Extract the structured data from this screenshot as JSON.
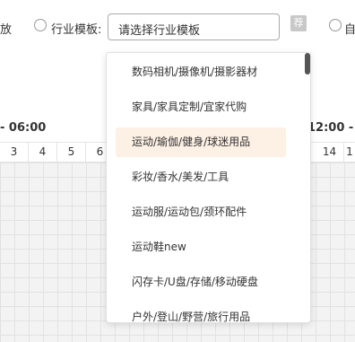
{
  "top": {
    "left_cut_text": "放",
    "field_label": "行业模板:",
    "select_value": "请选择行业模板",
    "recommend_label": "荐",
    "right_cut_text": "自"
  },
  "timeline": {
    "left_range": "- 06:00",
    "right_range": "12:00 -",
    "hours": [
      "3",
      "4",
      "5",
      "6",
      "14",
      "1"
    ]
  },
  "dropdown": {
    "options": [
      {
        "label": "数码相机/摄像机/摄影器材"
      },
      {
        "label": "家具/家具定制/宜家代购"
      },
      {
        "label": "运动/瑜伽/健身/球迷用品",
        "active": true
      },
      {
        "label": "彩妆/香水/美发/工具"
      },
      {
        "label": "运动服/运动包/颈环配件"
      },
      {
        "label": "运动鞋new"
      },
      {
        "label": "闪存卡/U盘/存储/移动硬盘"
      },
      {
        "label": "户外/登山/野营/旅行用品"
      }
    ]
  }
}
